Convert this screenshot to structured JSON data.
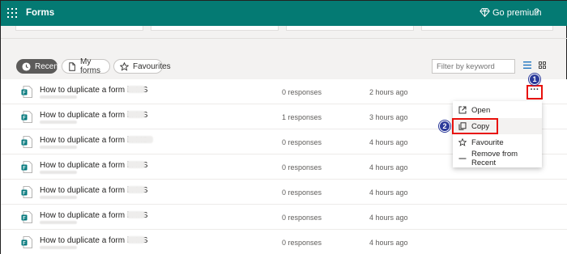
{
  "header": {
    "app_title": "Forms",
    "premium_label": "Go premium",
    "help_label": "?",
    "icons": [
      "waffle-icon",
      "diamond-icon",
      "help-icon"
    ]
  },
  "filters": {
    "tabs": [
      {
        "label": "Recent",
        "icon": "clock-icon",
        "active": true
      },
      {
        "label": "My forms",
        "icon": "document-icon",
        "active": false
      },
      {
        "label": "Favourites",
        "icon": "star-icon",
        "active": false
      }
    ],
    "search_placeholder": "Filter by keyword"
  },
  "rows": [
    {
      "title": "How to duplicate a form in MS",
      "responses": "0 responses",
      "time": "2 hours ago"
    },
    {
      "title": "How to duplicate a form in MS",
      "responses": "1 responses",
      "time": "3 hours ago"
    },
    {
      "title": "How to duplicate a form in MS",
      "responses": "0 responses",
      "time": "4 hours ago"
    },
    {
      "title": "How to duplicate a form in MS",
      "responses": "0 responses",
      "time": "4 hours ago"
    },
    {
      "title": "How to duplicate a form in MS",
      "responses": "0 responses",
      "time": "4 hours ago"
    },
    {
      "title": "How to duplicate a form in MS",
      "responses": "0 responses",
      "time": "4 hours ago"
    },
    {
      "title": "How to duplicate a form in MS",
      "responses": "0 responses",
      "time": "4 hours ago"
    }
  ],
  "more_button": {
    "label": "···"
  },
  "context_menu": {
    "items": [
      {
        "label": "Open",
        "icon": "open-external-icon"
      },
      {
        "label": "Copy",
        "icon": "copy-icon"
      },
      {
        "label": "Favourite",
        "icon": "star-icon"
      },
      {
        "label": "Remove from Recent",
        "icon": "minus-icon"
      }
    ]
  },
  "step_badges": [
    "1",
    "2"
  ],
  "colors": {
    "header_bg": "#047a73",
    "active_pill": "#5c5b5a",
    "highlight": "#e8110c",
    "badge": "#2b3a9a",
    "form_icon": "#03787c"
  }
}
